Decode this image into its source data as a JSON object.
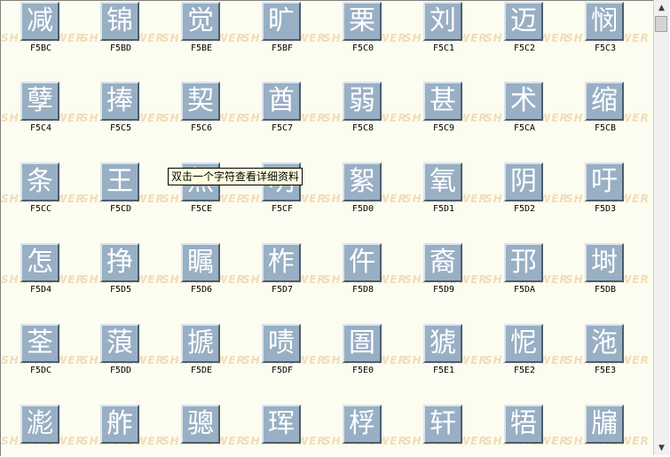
{
  "watermark_text": "SHX VIEWER",
  "tooltip": "双击一个字符查看详细资料",
  "scrollbar": {
    "up_arrow": "▲",
    "down_arrow": "▼"
  },
  "glyphs": [
    [
      {
        "char": "减",
        "code": "F5BC"
      },
      {
        "char": "锦",
        "code": "F5BD"
      },
      {
        "char": "觉",
        "code": "F5BE"
      },
      {
        "char": "旷",
        "code": "F5BF"
      },
      {
        "char": "栗",
        "code": "F5C0"
      },
      {
        "char": "刘",
        "code": "F5C1"
      },
      {
        "char": "迈",
        "code": "F5C2"
      },
      {
        "char": "悯",
        "code": "F5C3"
      }
    ],
    [
      {
        "char": "孽",
        "code": "F5C4"
      },
      {
        "char": "捧",
        "code": "F5C5"
      },
      {
        "char": "契",
        "code": "F5C6"
      },
      {
        "char": "酋",
        "code": "F5C7"
      },
      {
        "char": "弱",
        "code": "F5C8"
      },
      {
        "char": "甚",
        "code": "F5C9"
      },
      {
        "char": "术",
        "code": "F5CA"
      },
      {
        "char": "缩",
        "code": "F5CB"
      }
    ],
    [
      {
        "char": "条",
        "code": "F5CC"
      },
      {
        "char": "王",
        "code": "F5CD"
      },
      {
        "char": "然",
        "code": "F5CE"
      },
      {
        "char": "明",
        "code": "F5CF"
      },
      {
        "char": "絮",
        "code": "F5D0"
      },
      {
        "char": "氧",
        "code": "F5D1"
      },
      {
        "char": "阴",
        "code": "F5D2"
      },
      {
        "char": "吁",
        "code": "F5D3"
      }
    ],
    [
      {
        "char": "怎",
        "code": "F5D4"
      },
      {
        "char": "挣",
        "code": "F5D5"
      },
      {
        "char": "瞩",
        "code": "F5D6"
      },
      {
        "char": "柞",
        "code": "F5D7"
      },
      {
        "char": "仵",
        "code": "F5D8"
      },
      {
        "char": "裔",
        "code": "F5D9"
      },
      {
        "char": "邘",
        "code": "F5DA"
      },
      {
        "char": "埘",
        "code": "F5DB"
      }
    ],
    [
      {
        "char": "荃",
        "code": "F5DC"
      },
      {
        "char": "蒗",
        "code": "F5DD"
      },
      {
        "char": "搋",
        "code": "F5DE"
      },
      {
        "char": "啧",
        "code": "F5DF"
      },
      {
        "char": "圄",
        "code": "F5E0"
      },
      {
        "char": "猇",
        "code": "F5E1"
      },
      {
        "char": "怩",
        "code": "F5E2"
      },
      {
        "char": "沲",
        "code": "F5E3"
      }
    ],
    [
      {
        "char": "滮",
        "code": ""
      },
      {
        "char": "舴",
        "code": ""
      },
      {
        "char": "骢",
        "code": ""
      },
      {
        "char": "珲",
        "code": ""
      },
      {
        "char": "桴",
        "code": ""
      },
      {
        "char": "轩",
        "code": ""
      },
      {
        "char": "牾",
        "code": ""
      },
      {
        "char": "牖",
        "code": ""
      }
    ]
  ]
}
